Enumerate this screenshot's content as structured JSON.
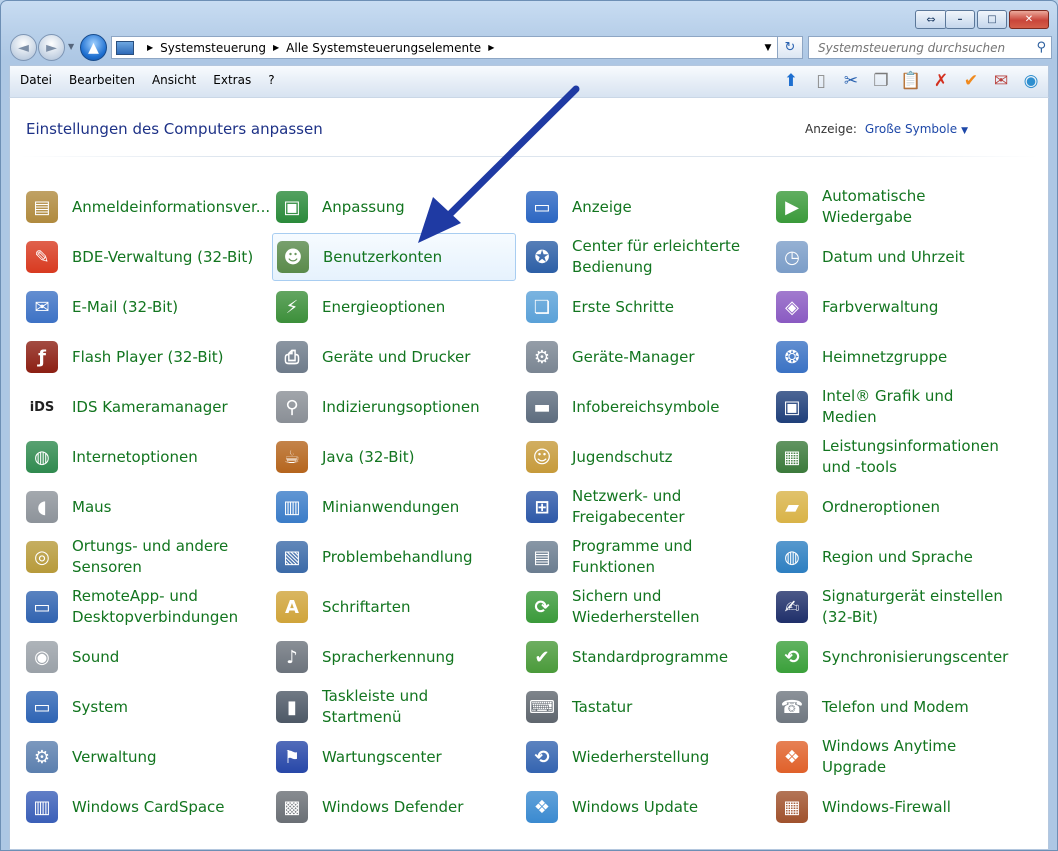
{
  "window": {
    "caption": {
      "resize": "⇔",
      "minimize": "–",
      "maximize": "□",
      "close": "✕"
    }
  },
  "nav": {
    "back": "◄",
    "forward": "►",
    "up": "▲",
    "history": "▼",
    "breadcrumbs": [
      "Systemsteuerung",
      "Alle Systemsteuerungselemente"
    ],
    "separator": "▶",
    "address_dropdown": "▼",
    "refresh": "↻",
    "search_placeholder": "Systemsteuerung durchsuchen",
    "search_icon": "⚲"
  },
  "menu": {
    "items": [
      "Datei",
      "Bearbeiten",
      "Ansicht",
      "Extras",
      "?"
    ]
  },
  "toolbar": {
    "icons": [
      {
        "name": "up-icon",
        "glyph": "⬆",
        "color": "#1e6fd0"
      },
      {
        "name": "panel-icon",
        "glyph": "▯",
        "color": "#8a8a8a"
      },
      {
        "name": "scissors-icon",
        "glyph": "✂",
        "color": "#2a62b0"
      },
      {
        "name": "copy-icon",
        "glyph": "❐",
        "color": "#7b7b7b"
      },
      {
        "name": "paste-icon",
        "glyph": "📋",
        "color": "#9c6a23"
      },
      {
        "name": "delete-icon",
        "glyph": "✗",
        "color": "#d32f1f"
      },
      {
        "name": "check-icon",
        "glyph": "✔",
        "color": "#f08a1e"
      },
      {
        "name": "mail-icon",
        "glyph": "✉",
        "color": "#b9413d"
      },
      {
        "name": "shell-icon",
        "glyph": "◉",
        "color": "#2f8fcf"
      }
    ]
  },
  "content": {
    "title": "Einstellungen des Computers anpassen",
    "view_label": "Anzeige:",
    "view_value": "Große Symbole",
    "view_arrow": "▼"
  },
  "items": [
    {
      "label": "Anmeldeinformationsver...",
      "icon": "vault-icon",
      "glyph": "▤",
      "color": "#b08a3e"
    },
    {
      "label": "Anpassung",
      "icon": "personalization-icon",
      "glyph": "▣",
      "color": "#2a8a3a"
    },
    {
      "label": "Anzeige",
      "icon": "display-icon",
      "glyph": "▭",
      "color": "#2b66c2"
    },
    {
      "label": "Automatische Wiedergabe",
      "icon": "autoplay-icon",
      "glyph": "▶",
      "color": "#3a9a3a"
    },
    {
      "label": "BDE-Verwaltung (32-Bit)",
      "icon": "bde-icon",
      "glyph": "✎",
      "color": "#d83a20"
    },
    {
      "label": "Benutzerkonten",
      "icon": "user-accounts-icon",
      "glyph": "☻",
      "color": "#5a8a4a",
      "hover": true
    },
    {
      "label": "Center für erleichterte Bedienung",
      "icon": "accessibility-icon",
      "glyph": "✪",
      "color": "#2c5fa6"
    },
    {
      "label": "Datum und Uhrzeit",
      "icon": "clock-icon",
      "glyph": "◷",
      "color": "#7b9dc8"
    },
    {
      "label": "E-Mail (32-Bit)",
      "icon": "mail-icon",
      "glyph": "✉",
      "color": "#3d72c5"
    },
    {
      "label": "Energieoptionen",
      "icon": "battery-icon",
      "glyph": "⚡",
      "color": "#3c8f3a"
    },
    {
      "label": "Erste Schritte",
      "icon": "getting-started-icon",
      "glyph": "❏",
      "color": "#5aa1d8"
    },
    {
      "label": "Farbverwaltung",
      "icon": "color-icon",
      "glyph": "◈",
      "color": "#8a5ac2"
    },
    {
      "label": "Flash Player (32-Bit)",
      "icon": "flash-icon",
      "glyph": "ƒ",
      "color": "#8c1f13"
    },
    {
      "label": "Geräte und Drucker",
      "icon": "printer-icon",
      "glyph": "⎙",
      "color": "#6e7b8a"
    },
    {
      "label": "Geräte-Manager",
      "icon": "device-manager-icon",
      "glyph": "⚙",
      "color": "#7a8592"
    },
    {
      "label": "Heimnetzgruppe",
      "icon": "homegroup-icon",
      "glyph": "❂",
      "color": "#3a72c4"
    },
    {
      "label": "IDS Kameramanager",
      "icon": "ids-icon",
      "glyph": "iDS",
      "color": "#222222"
    },
    {
      "label": "Indizierungsoptionen",
      "icon": "indexing-icon",
      "glyph": "⚲",
      "color": "#8a8f96"
    },
    {
      "label": "Infobereichsymbole",
      "icon": "notification-icon",
      "glyph": "▬",
      "color": "#5d6c7e"
    },
    {
      "label": "Intel® Grafik und Medien",
      "icon": "intel-icon",
      "glyph": "▣",
      "color": "#1f3f7a"
    },
    {
      "label": "Internetoptionen",
      "icon": "internet-icon",
      "glyph": "◍",
      "color": "#2f8a4f"
    },
    {
      "label": "Java (32-Bit)",
      "icon": "java-icon",
      "glyph": "☕",
      "color": "#b5651d"
    },
    {
      "label": "Jugendschutz",
      "icon": "parental-icon",
      "glyph": "☺",
      "color": "#c69a3a"
    },
    {
      "label": "Leistungsinformationen und -tools",
      "icon": "performance-icon",
      "glyph": "▦",
      "color": "#3b7a3b"
    },
    {
      "label": "Maus",
      "icon": "mouse-icon",
      "glyph": "◖",
      "color": "#8d939a"
    },
    {
      "label": "Minianwendungen",
      "icon": "gadgets-icon",
      "glyph": "▥",
      "color": "#3a7cc8"
    },
    {
      "label": "Netzwerk- und Freigabecenter",
      "icon": "network-icon",
      "glyph": "⊞",
      "color": "#2d58a8"
    },
    {
      "label": "Ordneroptionen",
      "icon": "folder-icon",
      "glyph": "▰",
      "color": "#d9b347"
    },
    {
      "label": "Ortungs- und andere Sensoren",
      "icon": "sensor-icon",
      "glyph": "◎",
      "color": "#b79a3a"
    },
    {
      "label": "Problembehandlung",
      "icon": "troubleshoot-icon",
      "glyph": "▧",
      "color": "#3b6aa8"
    },
    {
      "label": "Programme und Funktionen",
      "icon": "programs-icon",
      "glyph": "▤",
      "color": "#6b7d90"
    },
    {
      "label": "Region und Sprache",
      "icon": "globe-icon",
      "glyph": "◍",
      "color": "#2d7fc1"
    },
    {
      "label": "RemoteApp- und Desktopverbindungen",
      "icon": "remoteapp-icon",
      "glyph": "▭",
      "color": "#3063b0"
    },
    {
      "label": "Schriftarten",
      "icon": "fonts-icon",
      "glyph": "A",
      "color": "#d0a43a"
    },
    {
      "label": "Sichern und Wiederherstellen",
      "icon": "backup-icon",
      "glyph": "⟳",
      "color": "#3a9a3a"
    },
    {
      "label": "Signaturgerät einstellen (32-Bit)",
      "icon": "signature-icon",
      "glyph": "✍",
      "color": "#1f2f6a"
    },
    {
      "label": "Sound",
      "icon": "sound-icon",
      "glyph": "◉",
      "color": "#9aa1a8"
    },
    {
      "label": "Spracherkennung",
      "icon": "microphone-icon",
      "glyph": "♪",
      "color": "#6c737c"
    },
    {
      "label": "Standardprogramme",
      "icon": "default-programs-icon",
      "glyph": "✔",
      "color": "#4a9a3a"
    },
    {
      "label": "Synchronisierungscenter",
      "icon": "sync-icon",
      "glyph": "⟲",
      "color": "#3aa03a"
    },
    {
      "label": "System",
      "icon": "system-icon",
      "glyph": "▭",
      "color": "#2e64b4"
    },
    {
      "label": "Taskleiste und Startmenü",
      "icon": "taskbar-icon",
      "glyph": "▮",
      "color": "#4d5866"
    },
    {
      "label": "Tastatur",
      "icon": "keyboard-icon",
      "glyph": "⌨",
      "color": "#5f666e"
    },
    {
      "label": "Telefon und Modem",
      "icon": "phone-icon",
      "glyph": "☎",
      "color": "#6f7780"
    },
    {
      "label": "Verwaltung",
      "icon": "admin-tools-icon",
      "glyph": "⚙",
      "color": "#5b7fae"
    },
    {
      "label": "Wartungscenter",
      "icon": "action-center-icon",
      "glyph": "⚑",
      "color": "#2747a8"
    },
    {
      "label": "Wiederherstellung",
      "icon": "recovery-icon",
      "glyph": "⟲",
      "color": "#3464b0"
    },
    {
      "label": "Windows Anytime Upgrade",
      "icon": "windows-flag-icon",
      "glyph": "❖",
      "color": "#e0612a"
    },
    {
      "label": "Windows CardSpace",
      "icon": "cardspace-icon",
      "glyph": "▥",
      "color": "#3a5fb8"
    },
    {
      "label": "Windows Defender",
      "icon": "defender-icon",
      "glyph": "▩",
      "color": "#6a6f75"
    },
    {
      "label": "Windows Update",
      "icon": "windows-update-icon",
      "glyph": "❖",
      "color": "#3a8ad0"
    },
    {
      "label": "Windows-Firewall",
      "icon": "firewall-icon",
      "glyph": "▦",
      "color": "#a0522d"
    }
  ],
  "colors": {
    "link_green": "#12751f",
    "title_blue": "#1e3287",
    "arrow_blue": "#1f3aa3"
  }
}
